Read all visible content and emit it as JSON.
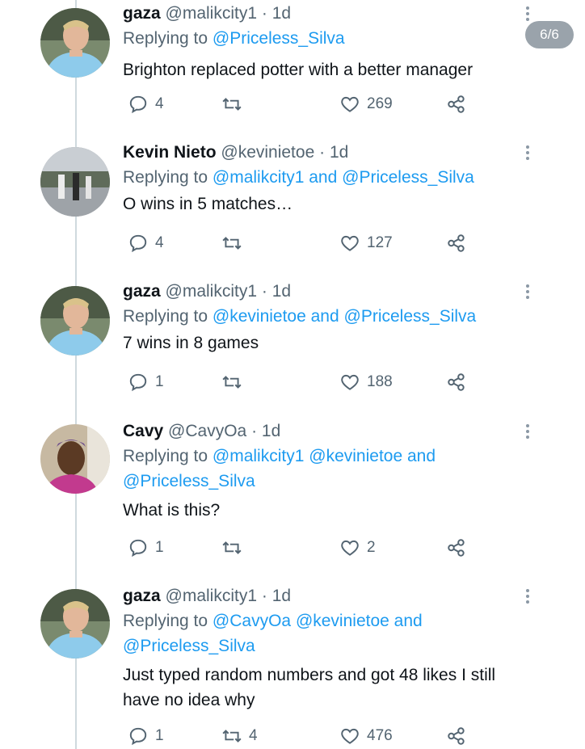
{
  "page_indicator": "6/6",
  "tweets": [
    {
      "name": "gaza",
      "handle": "@malikcity1",
      "sep": " · ",
      "time": "1d",
      "reply_prefix": "Replying to ",
      "reply_line1_rest": "@Priceless_Silva",
      "text1": "Brighton replaced potter with a better manager",
      "reply_count": "4",
      "retweet_count": "",
      "like_count": "269"
    },
    {
      "name": "Kevin Nieto",
      "handle": "@kevinietoe",
      "sep": " · ",
      "time": "1d",
      "reply_prefix": "Replying to ",
      "m1": "@malikcity1",
      "and": " and ",
      "m2": "@Priceless_Silva",
      "text1": "O wins in 5 matches…",
      "reply_count": "4",
      "retweet_count": "",
      "like_count": "127"
    },
    {
      "name": "gaza",
      "handle": "@malikcity1",
      "sep": " · ",
      "time": "1d",
      "reply_prefix": "Replying to ",
      "m1": "@kevinietoe",
      "and": " and ",
      "m2": "@Priceless_Silva",
      "text1": "7 wins in 8 games",
      "reply_count": "1",
      "retweet_count": "",
      "like_count": "188"
    },
    {
      "name": "Cavy",
      "handle": "@CavyOa",
      "sep": " · ",
      "time": "1d",
      "reply_prefix": "Replying to ",
      "m1": "@malikcity1",
      "m2": "@kevinietoe",
      "and": " and",
      "m3": "@Priceless_Silva",
      "text1": "What is this?",
      "reply_count": "1",
      "retweet_count": "",
      "like_count": "2"
    },
    {
      "name": "gaza",
      "handle": "@malikcity1",
      "sep": " · ",
      "time": "1d",
      "reply_prefix": "Replying to ",
      "m1": "@CavyOa",
      "m2": "@kevinietoe",
      "and": " and",
      "m3": "@Priceless_Silva",
      "text1": "Just typed random numbers and got 48 likes I still",
      "text2": "have no idea why",
      "reply_count": "1",
      "retweet_count": "4",
      "like_count": "476"
    }
  ],
  "icons": {
    "reply": "reply-icon",
    "retweet": "retweet-icon",
    "like": "heart-icon",
    "share": "share-icon",
    "more": "more-options-icon"
  },
  "colors": {
    "link": "#1d9bf0",
    "muted": "#536471",
    "text": "#0f1419",
    "thread_line": "#cfd9de",
    "badge": "#9aa3ab"
  }
}
